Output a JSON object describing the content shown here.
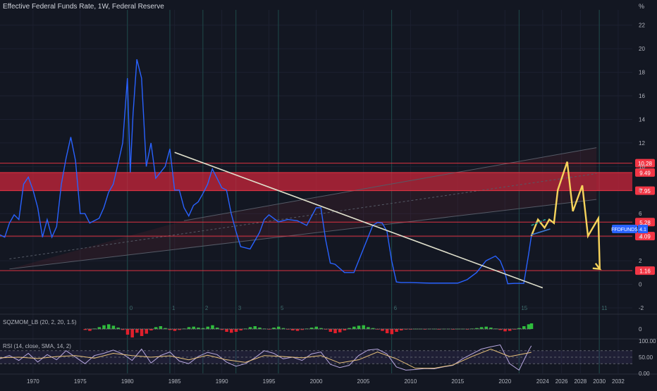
{
  "header": {
    "title": "Effective Federal Funds Rate, 1W, Federal Reserve",
    "unit_label": "%"
  },
  "colors": {
    "background": "#131722",
    "series_line": "#2962ff",
    "projection": "#f7d45c",
    "trendline": "#e0e0cc",
    "zone": "#d1263b",
    "level_line": "#f23645",
    "teal_line": "#26a69a",
    "ticker_badge": "#2962ff",
    "osc_positive": "#2ebd3c",
    "osc_negative": "#e0202c",
    "rsi_line": "#b8a8e0",
    "rsi_ma": "#e8c27a"
  },
  "chart_data": [
    {
      "type": "line",
      "title": "Effective Federal Funds Rate, 1W, Federal Reserve",
      "xlabel": "",
      "ylabel": "%",
      "xlim": [
        1966.5,
        2033.5
      ],
      "ylim": [
        -2.3,
        23.3
      ],
      "x_ticks": [
        "1970",
        "1975",
        "1980",
        "1985",
        "1990",
        "1995",
        "2000",
        "2005",
        "2010",
        "2015",
        "2020",
        "2024",
        "2026",
        "2028",
        "2030",
        "2032"
      ],
      "y_ticks": [
        "22",
        "20",
        "18",
        "16",
        "14",
        "12",
        "10",
        "8",
        "6",
        "4",
        "2",
        "0",
        "-2"
      ],
      "grid": true,
      "legend": "none",
      "series": [
        {
          "x": [
            1966.5,
            1967,
            1967.5,
            1968,
            1968.5,
            1969,
            1969.5,
            1970,
            1970.5,
            1971,
            1971.5,
            1972,
            1972.5,
            1973,
            1973.5,
            1974,
            1974.5,
            1975,
            1975.5,
            1976,
            1976.5,
            1977,
            1977.5,
            1978,
            1978.5,
            1979,
            1979.5,
            1980,
            1980.3,
            1980.6,
            1981,
            1981.5,
            1982,
            1982.5,
            1983,
            1983.5,
            1984,
            1984.5,
            1985,
            1985.5,
            1986,
            1986.5,
            1987,
            1987.5,
            1988,
            1988.5,
            1989,
            1989.5,
            1990,
            1990.5,
            1991,
            1991.5,
            1992,
            1993,
            1994,
            1994.5,
            1995,
            1996,
            1997,
            1998,
            1999,
            2000,
            2000.5,
            2001,
            2001.5,
            2002,
            2003,
            2004,
            2004.5,
            2005,
            2006,
            2006.5,
            2007,
            2007.5,
            2008,
            2008.5,
            2009,
            2010,
            2012,
            2014,
            2015,
            2016,
            2017,
            2018,
            2019,
            2019.5,
            2020,
            2020.3,
            2021,
            2022,
            2022.5,
            2022.8
          ],
          "values": [
            4.2,
            4.0,
            5.2,
            5.9,
            5.5,
            8.5,
            9.1,
            8.0,
            6.5,
            4.0,
            5.5,
            4.0,
            4.9,
            8.5,
            10.7,
            12.5,
            10.5,
            6.0,
            6.0,
            5.2,
            5.4,
            5.6,
            6.5,
            7.8,
            8.5,
            10.2,
            12.0,
            17.5,
            9.5,
            14.5,
            19.1,
            17.5,
            10.0,
            12.0,
            9.0,
            9.5,
            10.0,
            11.5,
            8.0,
            8.0,
            6.5,
            5.8,
            6.7,
            7.0,
            7.7,
            8.5,
            9.8,
            9.0,
            8.2,
            8.0,
            6.0,
            4.5,
            3.2,
            3.0,
            4.4,
            5.5,
            5.9,
            5.3,
            5.5,
            5.4,
            5.0,
            6.5,
            6.5,
            3.8,
            1.8,
            1.7,
            1.0,
            1.0,
            2.0,
            3.0,
            5.0,
            5.25,
            5.2,
            4.5,
            2.0,
            0.2,
            0.15,
            0.15,
            0.1,
            0.1,
            0.1,
            0.4,
            1.0,
            2.0,
            2.4,
            2.0,
            1.0,
            0.05,
            0.08,
            0.08,
            2.5,
            4.1
          ]
        },
        {
          "name": "projection",
          "x": [
            2022.8,
            2023.5,
            2024.2,
            2024.7,
            2025.2,
            2025.6,
            2026.6,
            2027.2,
            2028.2,
            2028.8,
            2029.9,
            2030.05
          ],
          "values": [
            4.1,
            5.5,
            4.8,
            5.5,
            5.2,
            8.0,
            10.4,
            6.2,
            8.4,
            4.1,
            5.6,
            1.3
          ]
        }
      ],
      "overlays": {
        "trendline": {
          "x": [
            1985,
            2024
          ],
          "values": [
            11.2,
            -0.3
          ]
        },
        "zone": {
          "from": 7.95,
          "to": 9.49
        },
        "channel": {
          "upper": {
            "x": [
              1986,
              2029.7
            ],
            "values": [
              5.4,
              11.6
            ]
          },
          "lower": {
            "x": [
              1967.5,
              2029.7
            ],
            "values": [
              1.3,
              7.2
            ]
          }
        },
        "price_lines": [
          {
            "label": "10.28",
            "value": 10.28
          },
          {
            "label": "9.49",
            "value": 9.49
          },
          {
            "label": "7.95",
            "value": 7.95
          },
          {
            "label": "5.28",
            "value": 5.28
          },
          {
            "label": "4.09",
            "value": 4.09
          },
          {
            "label": "1.16",
            "value": 1.16
          }
        ],
        "teal_segment": {
          "x": [
            2022.8,
            2024.3
          ],
          "values": [
            5.0,
            5.5
          ]
        },
        "blue_segment": {
          "x": [
            2022.8,
            2024.8
          ],
          "values": [
            4.2,
            4.7
          ]
        },
        "ticker_badge": {
          "symbol": "FFDFUNDS",
          "value": "4.1"
        },
        "cycle_markers": {
          "x": [
            1980,
            1984.5,
            1988,
            1991.5,
            1996,
            2008,
            2021.5,
            2030
          ],
          "labels": [
            "0",
            "1",
            "2",
            "3",
            "5",
            "6",
            "15",
            "11"
          ]
        }
      }
    },
    {
      "type": "bar",
      "title": "SQZMOM_LB (20, 2, 20, 1.5)",
      "xlim": [
        1966.5,
        2033.5
      ],
      "y_ticks": [
        "0"
      ],
      "series": [
        {
          "x": [
            1975.5,
            1976,
            1976.5,
            1977,
            1977.5,
            1978,
            1978.5,
            1979,
            1979.5,
            1980,
            1980.5,
            1981,
            1981.5,
            1982,
            1982.5,
            1983,
            1983.5,
            1984,
            1984.5,
            1985,
            1985.5,
            1986,
            1986.5,
            1987,
            1987.5,
            1988,
            1988.5,
            1989,
            1989.5,
            1990,
            1990.5,
            1991,
            1991.5,
            1992,
            1992.5,
            1993,
            1993.5,
            1994,
            1994.5,
            1995,
            1995.5,
            1996,
            1996.5,
            1997,
            1997.5,
            1998,
            1998.5,
            1999,
            1999.5,
            2000,
            2000.5,
            2001,
            2001.5,
            2002,
            2002.5,
            2003,
            2003.5,
            2004,
            2004.5,
            2005,
            2005.5,
            2006,
            2006.5,
            2007,
            2007.5,
            2008,
            2008.5,
            2009,
            2009.5,
            2010,
            2010.5,
            2011,
            2011.5,
            2012,
            2012.5,
            2013,
            2013.5,
            2014,
            2014.5,
            2015,
            2015.5,
            2016,
            2016.5,
            2017,
            2017.5,
            2018,
            2018.5,
            2019,
            2019.5,
            2020,
            2020.5,
            2021,
            2021.5,
            2022,
            2022.5,
            2022.8
          ],
          "values": [
            -0.2,
            -0.4,
            0.1,
            0.4,
            0.8,
            1.0,
            0.7,
            0.3,
            -0.2,
            -1.2,
            -1.8,
            -0.8,
            -1.5,
            -1.0,
            -0.3,
            0.4,
            0.6,
            0.2,
            -0.2,
            -0.4,
            -0.2,
            0.1,
            0.4,
            0.5,
            0.3,
            0.2,
            0.5,
            0.8,
            0.3,
            -0.2,
            -0.6,
            -0.8,
            -0.6,
            -0.3,
            0.1,
            0.4,
            0.6,
            0.3,
            0.1,
            -0.1,
            0.3,
            0.5,
            0.2,
            -0.1,
            -0.3,
            -0.4,
            -0.2,
            0.1,
            0.3,
            0.5,
            0.2,
            -0.1,
            -0.6,
            -0.9,
            -0.7,
            -0.3,
            0.2,
            0.5,
            0.7,
            0.8,
            0.4,
            0.2,
            -0.1,
            -0.4,
            -0.9,
            -1.1,
            -0.6,
            -0.3,
            -0.1,
            -0.05,
            0.05,
            0.05,
            -0.05,
            0.05,
            0.05,
            -0.05,
            0.05,
            0.05,
            -0.05,
            0.05,
            0.05,
            -0.05,
            0.1,
            0.2,
            0.4,
            0.5,
            0.3,
            0.1,
            -0.2,
            -0.5,
            -0.4,
            -0.1,
            0.2,
            0.6,
            1.0,
            1.2
          ]
        }
      ]
    },
    {
      "type": "line",
      "title": "RSI (14, close, SMA, 14, 2)",
      "xlim": [
        1966.5,
        2033.5
      ],
      "ylim": [
        0,
        100
      ],
      "y_ticks": [
        "100.00",
        "50.00",
        "0.00"
      ],
      "bands": [
        30,
        50,
        70
      ],
      "series": [
        {
          "name": "RSI",
          "x": [
            1966.5,
            1967.5,
            1968.5,
            1969.5,
            1970.5,
            1971.5,
            1972.5,
            1973.5,
            1974.5,
            1975.5,
            1976.5,
            1977.5,
            1978.5,
            1979.5,
            1980.5,
            1981.5,
            1982.5,
            1983.5,
            1984.5,
            1985.5,
            1986.5,
            1987.5,
            1988.5,
            1989.5,
            1990.5,
            1991.5,
            1992.5,
            1993.5,
            1994.5,
            1995.5,
            1996.5,
            1997.5,
            1998.5,
            1999.5,
            2000.5,
            2001.5,
            2002.5,
            2003.5,
            2004.5,
            2005.5,
            2006.5,
            2007.5,
            2008.5,
            2009.5,
            2010.5,
            2011.5,
            2012.5,
            2013.5,
            2014.5,
            2015.5,
            2016.5,
            2017.5,
            2018.5,
            2019.5,
            2020.5,
            2021.5,
            2022.5,
            2022.8
          ],
          "values": [
            45,
            55,
            40,
            62,
            35,
            58,
            42,
            70,
            50,
            30,
            55,
            62,
            72,
            60,
            40,
            75,
            32,
            55,
            66,
            38,
            30,
            52,
            65,
            58,
            35,
            22,
            30,
            48,
            70,
            62,
            45,
            50,
            40,
            60,
            66,
            28,
            18,
            25,
            55,
            72,
            75,
            60,
            20,
            10,
            12,
            15,
            14,
            20,
            25,
            45,
            60,
            75,
            82,
            88,
            30,
            10,
            70,
            85
          ]
        },
        {
          "name": "MA",
          "x": [
            1966.5,
            1968.5,
            1970.5,
            1972.5,
            1974.5,
            1976.5,
            1978.5,
            1980.5,
            1982.5,
            1984.5,
            1986.5,
            1988.5,
            1990.5,
            1992.5,
            1994.5,
            1996.5,
            1998.5,
            2000.5,
            2002.5,
            2004.5,
            2006.5,
            2008.5,
            2010.5,
            2012.5,
            2014.5,
            2016.5,
            2018.5,
            2020.5,
            2022.8
          ],
          "values": [
            48,
            50,
            46,
            52,
            55,
            47,
            62,
            55,
            50,
            54,
            42,
            56,
            42,
            34,
            55,
            52,
            48,
            55,
            32,
            42,
            66,
            45,
            16,
            16,
            26,
            52,
            75,
            52,
            65
          ]
        }
      ]
    }
  ]
}
